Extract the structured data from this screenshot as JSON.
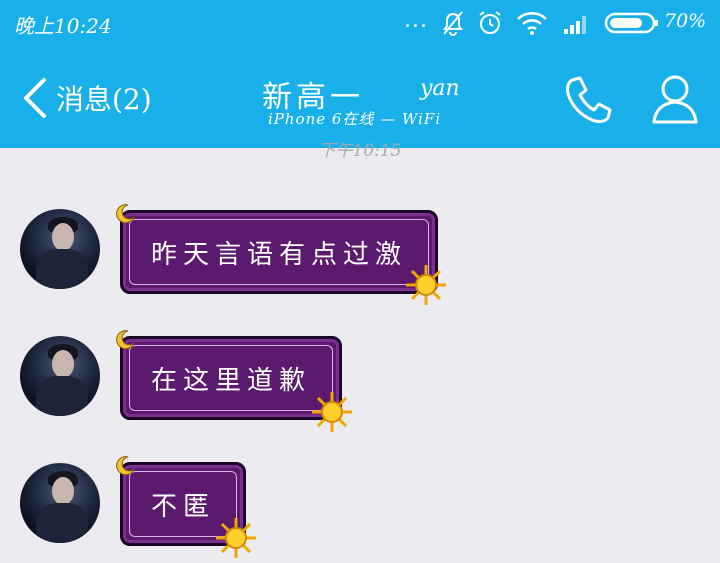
{
  "status_bar": {
    "time": "晚上10:24",
    "dots": "...",
    "battery_percent": "70%"
  },
  "header": {
    "back_label": "消息(2)",
    "title": "新高一",
    "title_suffix": "yan",
    "subtitle": "iPhone 6在线 — WiFi"
  },
  "timestamp": "下午10:15",
  "messages": [
    {
      "text": "昨天言语有点过激"
    },
    {
      "text": "在这里道歉"
    },
    {
      "text": "不匿"
    }
  ],
  "colors": {
    "header_bg": "#19b0ea",
    "bubble_bg": "#5b1a6e",
    "chat_bg": "#ebebf0"
  }
}
